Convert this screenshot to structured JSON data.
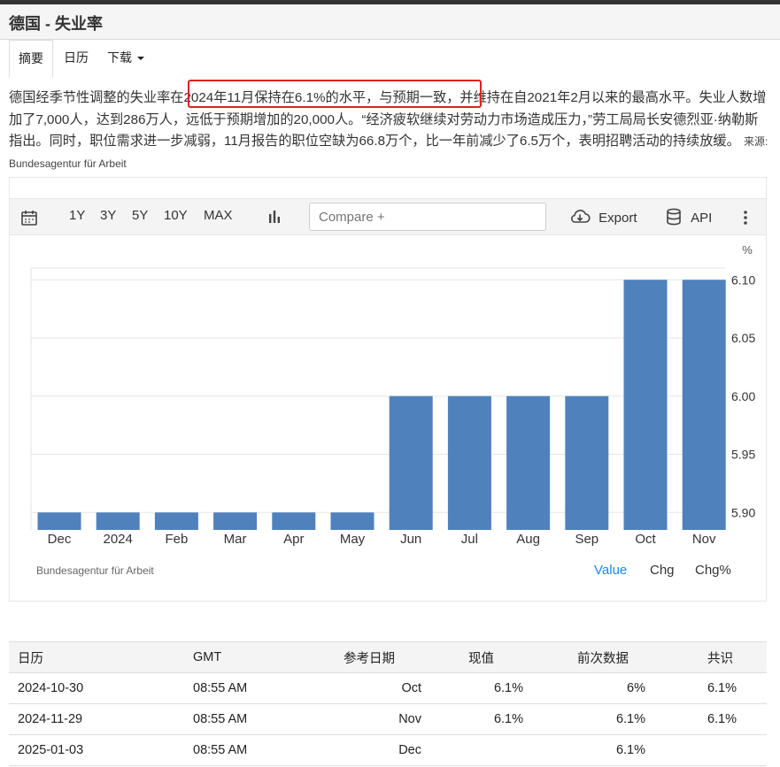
{
  "page_title": "德国 - 失业率",
  "tabs": {
    "summary": "摘要",
    "calendar": "日历",
    "download": "下载"
  },
  "description": {
    "pre": "德国经季节性调整的失业率在",
    "highlight": "2024年11月保持在6.1%的水平，与预期一致，",
    "post": "并维持在自2021年2月以来的最高水平。失业人数增加了7,000人，达到286万人，远低于预期增加的20,000人。“经济疲软继续对劳动力市场造成压力，”劳工局局长安德烈亚·纳勒斯指出。同时，职位需求进一步减弱，11月报告的职位空缺为66.8万个，比一年前减少了6.5万个，表明招聘活动的持续放缓。",
    "source_label": "来源:",
    "source": "Bundesagentur für Arbeit"
  },
  "toolbar": {
    "ranges": [
      "1Y",
      "3Y",
      "5Y",
      "10Y",
      "MAX"
    ],
    "compare_placeholder": "Compare +",
    "export": "Export",
    "api": "API"
  },
  "chart_data": {
    "type": "bar",
    "categories": [
      "Dec",
      "2024",
      "Feb",
      "Mar",
      "Apr",
      "May",
      "Jun",
      "Jul",
      "Aug",
      "Sep",
      "Oct",
      "Nov"
    ],
    "values": [
      5.9,
      5.9,
      5.9,
      5.9,
      5.9,
      5.9,
      6.0,
      6.0,
      6.0,
      6.0,
      6.1,
      6.1
    ],
    "unit": "%",
    "yticks": [
      "5.90",
      "5.95",
      "6.00",
      "6.05",
      "6.10"
    ],
    "ylim": [
      5.885,
      6.12
    ],
    "color": "#4f81bd",
    "source": "Bundesagentur für Arbeit",
    "grid": true
  },
  "chart_controls": {
    "value": "Value",
    "chg": "Chg",
    "chg_pct": "Chg%",
    "active_color": "#1e88e5"
  },
  "calendar": {
    "headers": [
      "日历",
      "GMT",
      "参考日期",
      "现值",
      "前次数据",
      "共识"
    ],
    "rows": [
      [
        "2024-10-30",
        "08:55 AM",
        "Oct",
        "6.1%",
        "6%",
        "6.1%"
      ],
      [
        "2024-11-29",
        "08:55 AM",
        "Nov",
        "6.1%",
        "6.1%",
        "6.1%"
      ],
      [
        "2025-01-03",
        "08:55 AM",
        "Dec",
        "",
        "6.1%",
        ""
      ]
    ]
  }
}
